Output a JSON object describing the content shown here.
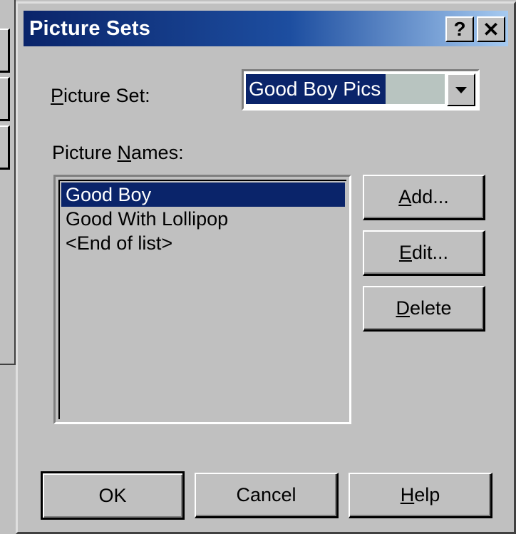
{
  "window": {
    "title": "Picture Sets",
    "help_glyph": "?",
    "close_glyph": "✕"
  },
  "picture_set": {
    "label_mnemonic": "P",
    "label_rest": "icture Set:",
    "selected_value": "Good Boy Pics"
  },
  "picture_names": {
    "label_prefix": "Picture ",
    "label_mnemonic": "N",
    "label_rest": "ames:",
    "items": [
      {
        "text": "Good Boy",
        "selected": true
      },
      {
        "text": "Good With Lollipop",
        "selected": false
      },
      {
        "text": "<End of list>",
        "selected": false
      }
    ]
  },
  "side_buttons": {
    "add_mnemonic": "A",
    "add_rest": "dd...",
    "edit_mnemonic": "E",
    "edit_rest": "dit...",
    "delete_mnemonic": "D",
    "delete_rest": "elete"
  },
  "footer_buttons": {
    "ok": "OK",
    "cancel": "Cancel",
    "help_mnemonic": "H",
    "help_rest": "elp"
  },
  "colors": {
    "dialog_face": "#c0c0c0",
    "title_gradient_start": "#0a246a",
    "title_gradient_end": "#a6caf0",
    "selection": "#0a246a"
  }
}
